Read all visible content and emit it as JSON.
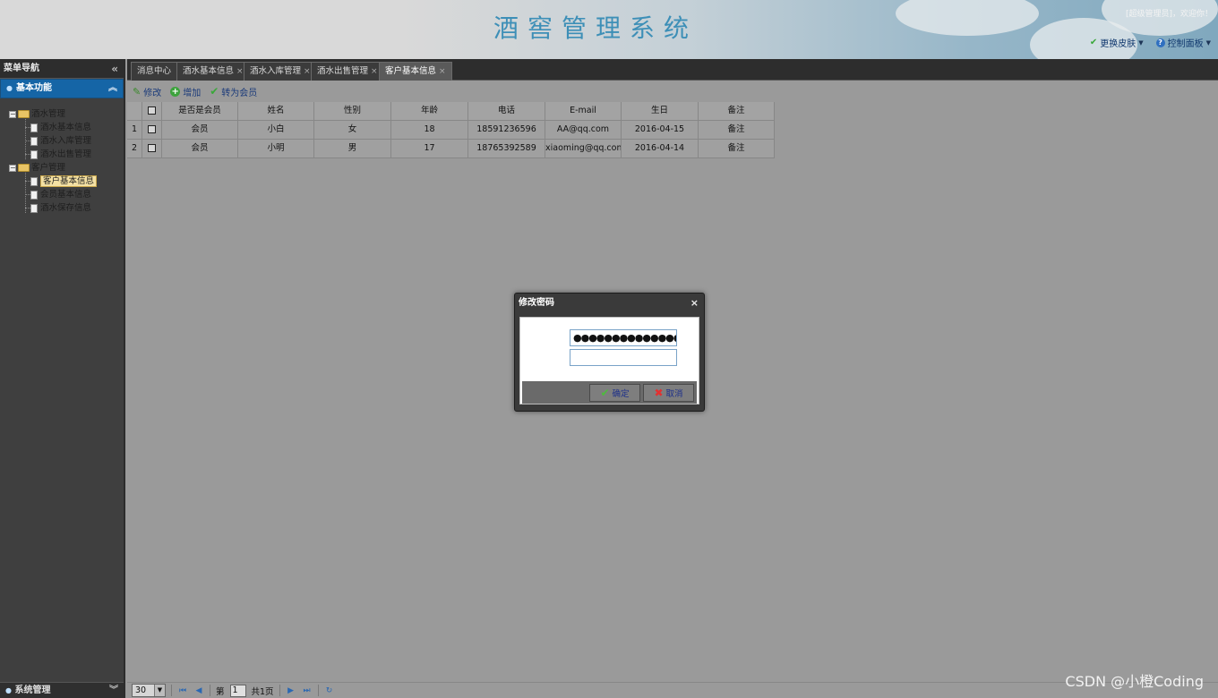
{
  "header": {
    "title": "酒窖管理系统",
    "welcome": "[超级管理员]，欢迎你！",
    "skin_link": "更换皮肤",
    "panel_link": "控制面板"
  },
  "sidebar": {
    "title": "菜单导航",
    "section": "基本功能",
    "footer": "系统管理",
    "tree": [
      {
        "label": "酒水管理",
        "type": "folder"
      },
      {
        "label": "酒水基本信息",
        "type": "file"
      },
      {
        "label": "酒水入库管理",
        "type": "file"
      },
      {
        "label": "酒水出售管理",
        "type": "file"
      },
      {
        "label": "客户管理",
        "type": "folder"
      },
      {
        "label": "客户基本信息",
        "type": "file",
        "selected": true
      },
      {
        "label": "会员基本信息",
        "type": "file"
      },
      {
        "label": "酒水保存信息",
        "type": "file"
      }
    ]
  },
  "tabs": [
    {
      "label": "消息中心"
    },
    {
      "label": "酒水基本信息"
    },
    {
      "label": "酒水入库管理"
    },
    {
      "label": "酒水出售管理"
    },
    {
      "label": "客户基本信息",
      "active": true
    }
  ],
  "toolbar": {
    "edit": "修改",
    "add": "增加",
    "to_member": "转为会员"
  },
  "grid": {
    "columns": [
      "是否是会员",
      "姓名",
      "性别",
      "年龄",
      "电话",
      "E-mail",
      "生日",
      "备注"
    ],
    "rows": [
      {
        "num": "1",
        "cells": [
          "会员",
          "小白",
          "女",
          "18",
          "18591236596",
          "AA@qq.com",
          "2016-04-15",
          "备注"
        ]
      },
      {
        "num": "2",
        "cells": [
          "会员",
          "小明",
          "男",
          "17",
          "18765392589",
          "xiaoming@qq.com",
          "2016-04-14",
          "备注"
        ]
      }
    ]
  },
  "pager": {
    "page_size": "30",
    "page_prefix": "第",
    "page_value": "1",
    "page_total": "共1页"
  },
  "dialog": {
    "title": "修改密码",
    "password_value": "●●●●●●●●●●●●●●●",
    "confirm_value": "",
    "ok": "确定",
    "cancel": "取消"
  },
  "watermark": "CSDN @小橙Coding",
  "colors": {
    "title_blue": "#3d8fb7",
    "accordion_blue": "#1565a6",
    "link_blue": "#1a3a7a"
  }
}
